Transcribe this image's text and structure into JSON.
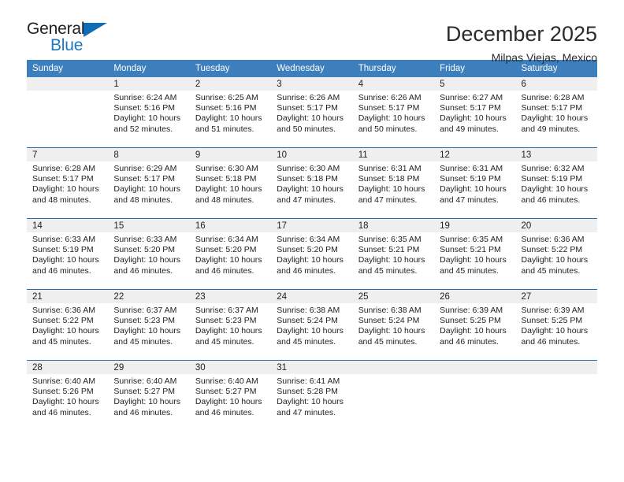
{
  "logo": {
    "word_top": "General",
    "word_bottom": "Blue",
    "triangle_icon": "triangle-icon"
  },
  "header": {
    "title": "December 2025",
    "subtitle": "Milpas Viejas, Mexico"
  },
  "colors": {
    "header_blue": "#3d7ebd",
    "row_divider_blue": "#2c6ca8",
    "daynum_band": "#efefef",
    "logo_blue": "#1a7ac0",
    "text": "#1f1f1f"
  },
  "calendar": {
    "weekdays": [
      "Sunday",
      "Monday",
      "Tuesday",
      "Wednesday",
      "Thursday",
      "Friday",
      "Saturday"
    ],
    "weeks": [
      [
        {
          "day": "",
          "sunrise": "",
          "sunset": "",
          "daylight": ""
        },
        {
          "day": "1",
          "sunrise": "Sunrise: 6:24 AM",
          "sunset": "Sunset: 5:16 PM",
          "daylight": "Daylight: 10 hours and 52 minutes."
        },
        {
          "day": "2",
          "sunrise": "Sunrise: 6:25 AM",
          "sunset": "Sunset: 5:16 PM",
          "daylight": "Daylight: 10 hours and 51 minutes."
        },
        {
          "day": "3",
          "sunrise": "Sunrise: 6:26 AM",
          "sunset": "Sunset: 5:17 PM",
          "daylight": "Daylight: 10 hours and 50 minutes."
        },
        {
          "day": "4",
          "sunrise": "Sunrise: 6:26 AM",
          "sunset": "Sunset: 5:17 PM",
          "daylight": "Daylight: 10 hours and 50 minutes."
        },
        {
          "day": "5",
          "sunrise": "Sunrise: 6:27 AM",
          "sunset": "Sunset: 5:17 PM",
          "daylight": "Daylight: 10 hours and 49 minutes."
        },
        {
          "day": "6",
          "sunrise": "Sunrise: 6:28 AM",
          "sunset": "Sunset: 5:17 PM",
          "daylight": "Daylight: 10 hours and 49 minutes."
        }
      ],
      [
        {
          "day": "7",
          "sunrise": "Sunrise: 6:28 AM",
          "sunset": "Sunset: 5:17 PM",
          "daylight": "Daylight: 10 hours and 48 minutes."
        },
        {
          "day": "8",
          "sunrise": "Sunrise: 6:29 AM",
          "sunset": "Sunset: 5:17 PM",
          "daylight": "Daylight: 10 hours and 48 minutes."
        },
        {
          "day": "9",
          "sunrise": "Sunrise: 6:30 AM",
          "sunset": "Sunset: 5:18 PM",
          "daylight": "Daylight: 10 hours and 48 minutes."
        },
        {
          "day": "10",
          "sunrise": "Sunrise: 6:30 AM",
          "sunset": "Sunset: 5:18 PM",
          "daylight": "Daylight: 10 hours and 47 minutes."
        },
        {
          "day": "11",
          "sunrise": "Sunrise: 6:31 AM",
          "sunset": "Sunset: 5:18 PM",
          "daylight": "Daylight: 10 hours and 47 minutes."
        },
        {
          "day": "12",
          "sunrise": "Sunrise: 6:31 AM",
          "sunset": "Sunset: 5:19 PM",
          "daylight": "Daylight: 10 hours and 47 minutes."
        },
        {
          "day": "13",
          "sunrise": "Sunrise: 6:32 AM",
          "sunset": "Sunset: 5:19 PM",
          "daylight": "Daylight: 10 hours and 46 minutes."
        }
      ],
      [
        {
          "day": "14",
          "sunrise": "Sunrise: 6:33 AM",
          "sunset": "Sunset: 5:19 PM",
          "daylight": "Daylight: 10 hours and 46 minutes."
        },
        {
          "day": "15",
          "sunrise": "Sunrise: 6:33 AM",
          "sunset": "Sunset: 5:20 PM",
          "daylight": "Daylight: 10 hours and 46 minutes."
        },
        {
          "day": "16",
          "sunrise": "Sunrise: 6:34 AM",
          "sunset": "Sunset: 5:20 PM",
          "daylight": "Daylight: 10 hours and 46 minutes."
        },
        {
          "day": "17",
          "sunrise": "Sunrise: 6:34 AM",
          "sunset": "Sunset: 5:20 PM",
          "daylight": "Daylight: 10 hours and 46 minutes."
        },
        {
          "day": "18",
          "sunrise": "Sunrise: 6:35 AM",
          "sunset": "Sunset: 5:21 PM",
          "daylight": "Daylight: 10 hours and 45 minutes."
        },
        {
          "day": "19",
          "sunrise": "Sunrise: 6:35 AM",
          "sunset": "Sunset: 5:21 PM",
          "daylight": "Daylight: 10 hours and 45 minutes."
        },
        {
          "day": "20",
          "sunrise": "Sunrise: 6:36 AM",
          "sunset": "Sunset: 5:22 PM",
          "daylight": "Daylight: 10 hours and 45 minutes."
        }
      ],
      [
        {
          "day": "21",
          "sunrise": "Sunrise: 6:36 AM",
          "sunset": "Sunset: 5:22 PM",
          "daylight": "Daylight: 10 hours and 45 minutes."
        },
        {
          "day": "22",
          "sunrise": "Sunrise: 6:37 AM",
          "sunset": "Sunset: 5:23 PM",
          "daylight": "Daylight: 10 hours and 45 minutes."
        },
        {
          "day": "23",
          "sunrise": "Sunrise: 6:37 AM",
          "sunset": "Sunset: 5:23 PM",
          "daylight": "Daylight: 10 hours and 45 minutes."
        },
        {
          "day": "24",
          "sunrise": "Sunrise: 6:38 AM",
          "sunset": "Sunset: 5:24 PM",
          "daylight": "Daylight: 10 hours and 45 minutes."
        },
        {
          "day": "25",
          "sunrise": "Sunrise: 6:38 AM",
          "sunset": "Sunset: 5:24 PM",
          "daylight": "Daylight: 10 hours and 45 minutes."
        },
        {
          "day": "26",
          "sunrise": "Sunrise: 6:39 AM",
          "sunset": "Sunset: 5:25 PM",
          "daylight": "Daylight: 10 hours and 46 minutes."
        },
        {
          "day": "27",
          "sunrise": "Sunrise: 6:39 AM",
          "sunset": "Sunset: 5:25 PM",
          "daylight": "Daylight: 10 hours and 46 minutes."
        }
      ],
      [
        {
          "day": "28",
          "sunrise": "Sunrise: 6:40 AM",
          "sunset": "Sunset: 5:26 PM",
          "daylight": "Daylight: 10 hours and 46 minutes."
        },
        {
          "day": "29",
          "sunrise": "Sunrise: 6:40 AM",
          "sunset": "Sunset: 5:27 PM",
          "daylight": "Daylight: 10 hours and 46 minutes."
        },
        {
          "day": "30",
          "sunrise": "Sunrise: 6:40 AM",
          "sunset": "Sunset: 5:27 PM",
          "daylight": "Daylight: 10 hours and 46 minutes."
        },
        {
          "day": "31",
          "sunrise": "Sunrise: 6:41 AM",
          "sunset": "Sunset: 5:28 PM",
          "daylight": "Daylight: 10 hours and 47 minutes."
        },
        {
          "day": "",
          "sunrise": "",
          "sunset": "",
          "daylight": ""
        },
        {
          "day": "",
          "sunrise": "",
          "sunset": "",
          "daylight": ""
        },
        {
          "day": "",
          "sunrise": "",
          "sunset": "",
          "daylight": ""
        }
      ]
    ]
  }
}
